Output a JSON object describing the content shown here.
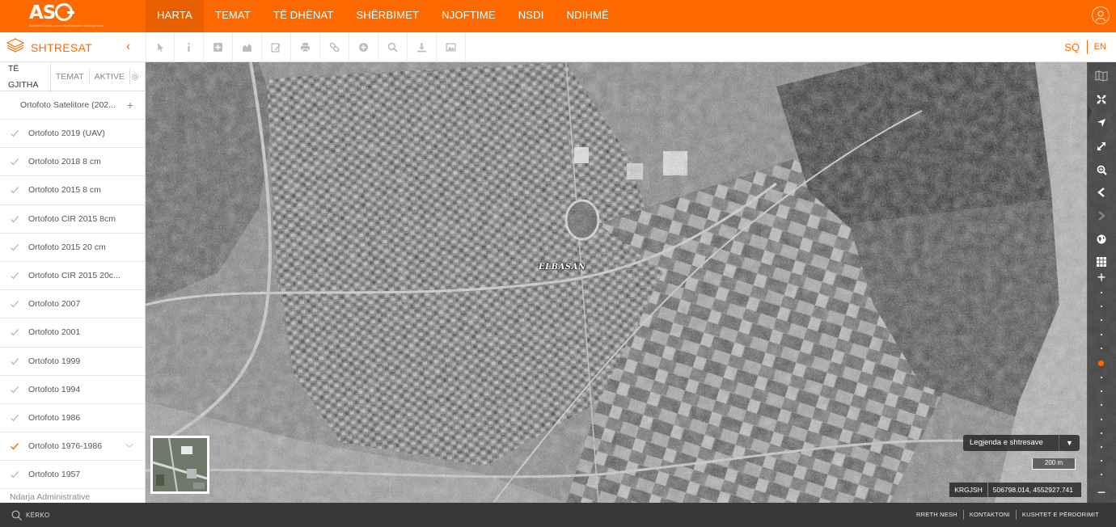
{
  "header": {
    "logo_text": "ASIG",
    "logo_subtitle": "Autoriteti Shtetëror për Informacionin Gjeohapësinor",
    "nav": [
      "HARTA",
      "TEMAT",
      "TË DHËNAT",
      "SHËRBIMET",
      "NJOFTIME",
      "NSDI",
      "NDIHMË"
    ],
    "active_nav": "HARTA"
  },
  "toolbar": {
    "layers_title": "SHTRESAT",
    "collapse_icon": "chevron-left-icon",
    "tools": [
      "pointer-icon",
      "info-icon",
      "add-icon",
      "profile-chart-icon",
      "edit-icon",
      "print-icon",
      "link-icon",
      "plus-circle-icon",
      "search-icon",
      "download-icon",
      "image-icon"
    ],
    "lang_sq": "SQ",
    "lang_en": "EN",
    "accent_color": "#ff6a00"
  },
  "sidebar": {
    "tabs": [
      "TË GJITHA",
      "TEMAT",
      "AKTIVE"
    ],
    "active_tab": "TË GJITHA",
    "top_layer": "Ortofoto Satelitore (202...",
    "layers": [
      {
        "label": "Ortofoto 2019 (UAV)",
        "checked": false
      },
      {
        "label": "Ortofoto 2018 8 cm",
        "checked": false
      },
      {
        "label": "Ortofoto 2015 8 cm",
        "checked": false
      },
      {
        "label": "Ortofoto CIR 2015 8cm",
        "checked": false
      },
      {
        "label": "Ortofoto 2015 20 cm",
        "checked": false
      },
      {
        "label": "Ortofoto CIR 2015 20c...",
        "checked": false
      },
      {
        "label": "Ortofoto 2007",
        "checked": false
      },
      {
        "label": "Ortofoto 2001",
        "checked": false
      },
      {
        "label": "Ortofoto 1999",
        "checked": false
      },
      {
        "label": "Ortofoto 1994",
        "checked": false
      },
      {
        "label": "Ortofoto 1986",
        "checked": false
      },
      {
        "label": "Ortofoto 1976-1986",
        "checked": true,
        "expandable": true
      },
      {
        "label": "Ortofoto 1957",
        "checked": false
      }
    ],
    "partial_item": "Ndarja Administrative"
  },
  "map": {
    "place_label": "ELBASAN",
    "legend_button": "Legjenda e shtresave",
    "scale": "200 m",
    "coord_system": "KRGJSH",
    "coordinates": "506798.014, 4552927.741",
    "zoom_level_index": 4,
    "rail_icons": [
      "basemap-icon",
      "fullscreen-icon",
      "locate-icon",
      "expand-icon",
      "zoom-box-icon",
      "back-icon",
      "forward-icon",
      "globe-icon",
      "grid-icon",
      "zoom-in-icon",
      "zoom-out-icon"
    ]
  },
  "footer": {
    "search_label": "KËRKO",
    "links": [
      "RRETH NESH",
      "KONTAKTONI",
      "KUSHTET E PËRDORIMIT"
    ]
  }
}
